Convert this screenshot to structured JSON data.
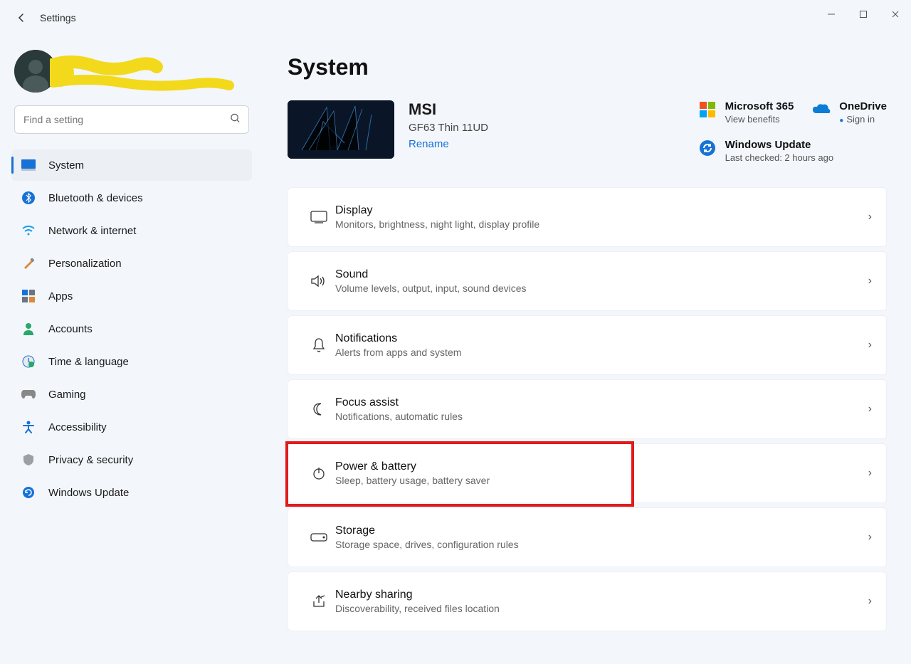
{
  "app_title": "Settings",
  "page_title": "System",
  "search": {
    "placeholder": "Find a setting"
  },
  "nav": [
    {
      "label": "System",
      "active": true
    },
    {
      "label": "Bluetooth & devices"
    },
    {
      "label": "Network & internet"
    },
    {
      "label": "Personalization"
    },
    {
      "label": "Apps"
    },
    {
      "label": "Accounts"
    },
    {
      "label": "Time & language"
    },
    {
      "label": "Gaming"
    },
    {
      "label": "Accessibility"
    },
    {
      "label": "Privacy & security"
    },
    {
      "label": "Windows Update"
    }
  ],
  "device": {
    "name": "MSI",
    "model": "GF63 Thin 11UD",
    "rename": "Rename"
  },
  "widgets": {
    "m365": {
      "title": "Microsoft 365",
      "sub": "View benefits"
    },
    "onedrive": {
      "title": "OneDrive",
      "sub": "Sign in"
    },
    "winupdate": {
      "title": "Windows Update",
      "sub": "Last checked: 2 hours ago"
    }
  },
  "items": {
    "display": {
      "title": "Display",
      "sub": "Monitors, brightness, night light, display profile"
    },
    "sound": {
      "title": "Sound",
      "sub": "Volume levels, output, input, sound devices"
    },
    "notifications": {
      "title": "Notifications",
      "sub": "Alerts from apps and system"
    },
    "focus": {
      "title": "Focus assist",
      "sub": "Notifications, automatic rules"
    },
    "power": {
      "title": "Power & battery",
      "sub": "Sleep, battery usage, battery saver"
    },
    "storage": {
      "title": "Storage",
      "sub": "Storage space, drives, configuration rules"
    },
    "nearby": {
      "title": "Nearby sharing",
      "sub": "Discoverability, received files location"
    }
  }
}
